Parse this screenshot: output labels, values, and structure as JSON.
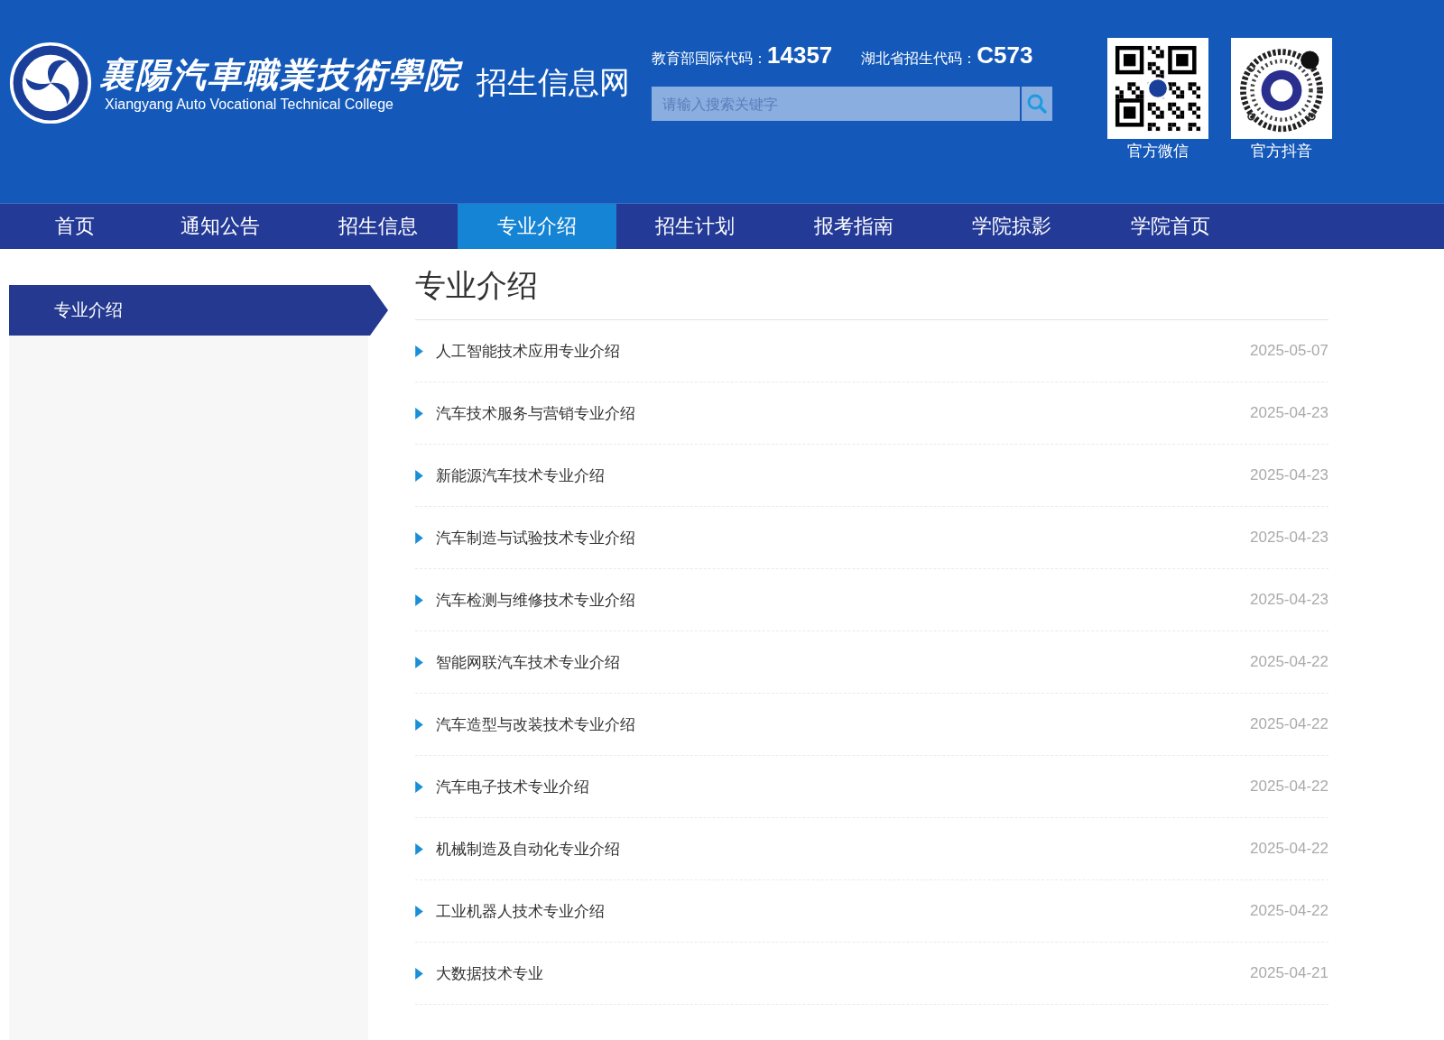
{
  "header": {
    "logo_title": "襄陽汽車職業技術學院",
    "logo_subtitle": "Xiangyang Auto Vocational Technical College",
    "site_name": "招生信息网",
    "codes": [
      {
        "label": "教育部国际代码：",
        "value": "14357"
      },
      {
        "label": "湖北省招生代码：",
        "value": "C573"
      }
    ],
    "search": {
      "placeholder": "请输入搜索关键字"
    },
    "qr_codes": [
      {
        "kind": "wechat",
        "caption": "官方微信"
      },
      {
        "kind": "douyin",
        "caption": "官方抖音"
      }
    ]
  },
  "nav": [
    {
      "label": "首页",
      "selected": false
    },
    {
      "label": "通知公告",
      "selected": false
    },
    {
      "label": "招生信息",
      "selected": false
    },
    {
      "label": "专业介绍",
      "selected": true
    },
    {
      "label": "招生计划",
      "selected": false
    },
    {
      "label": "报考指南",
      "selected": false
    },
    {
      "label": "学院掠影",
      "selected": false
    },
    {
      "label": "学院首页",
      "selected": false
    }
  ],
  "sidebar": {
    "items": [
      {
        "label": "专业介绍",
        "selected": true
      }
    ]
  },
  "content": {
    "title": "专业介绍",
    "articles": [
      {
        "title": "人工智能技术应用专业介绍",
        "date": "2025-05-07"
      },
      {
        "title": "汽车技术服务与营销专业介绍",
        "date": "2025-04-23"
      },
      {
        "title": "新能源汽车技术专业介绍",
        "date": "2025-04-23"
      },
      {
        "title": "汽车制造与试验技术专业介绍",
        "date": "2025-04-23"
      },
      {
        "title": "汽车检测与维修技术专业介绍",
        "date": "2025-04-23"
      },
      {
        "title": "智能网联汽车技术专业介绍",
        "date": "2025-04-22"
      },
      {
        "title": "汽车造型与改装技术专业介绍",
        "date": "2025-04-22"
      },
      {
        "title": "汽车电子技术专业介绍",
        "date": "2025-04-22"
      },
      {
        "title": "机械制造及自动化专业介绍",
        "date": "2025-04-22"
      },
      {
        "title": "工业机器人技术专业介绍",
        "date": "2025-04-22"
      },
      {
        "title": "大数据技术专业",
        "date": "2025-04-21"
      }
    ]
  }
}
